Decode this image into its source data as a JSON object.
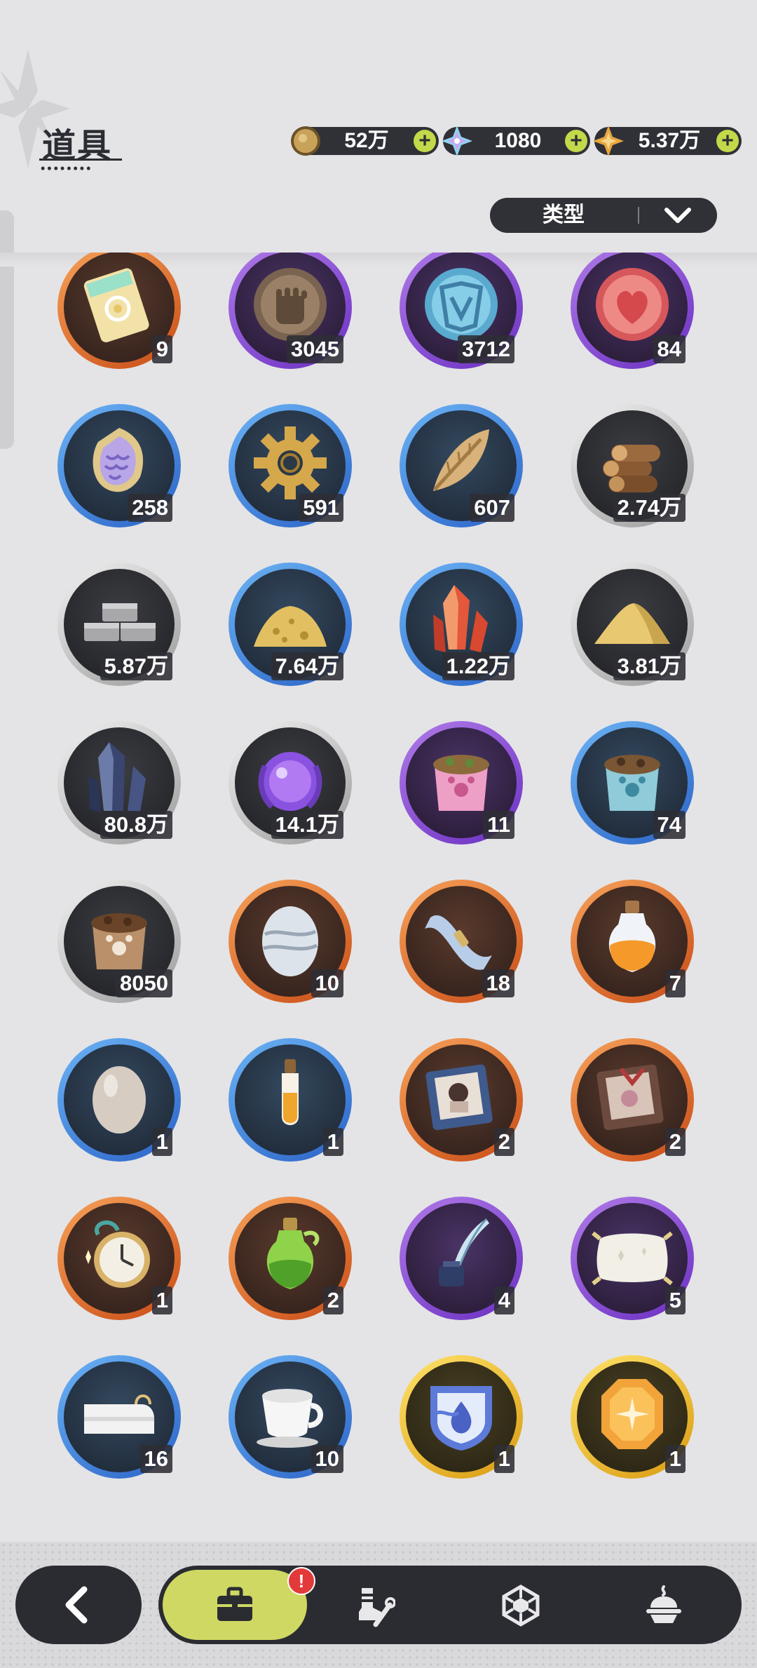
{
  "header": {
    "title": "道具"
  },
  "currencies": [
    {
      "name": "gold-coin",
      "amount": "52万",
      "plus": "+",
      "color": "#c9a25a"
    },
    {
      "name": "crystal-gem",
      "amount": "1080",
      "plus": "+",
      "color": "#8fd3f0"
    },
    {
      "name": "star-shard",
      "amount": "5.37万",
      "plus": "+",
      "color": "#e8a640"
    }
  ],
  "filter": {
    "label": "类型"
  },
  "items": [
    {
      "icon": "rainbow-ticket-icon",
      "rarity": "orange",
      "count": "9"
    },
    {
      "icon": "fist-coin-icon",
      "rarity": "purple",
      "count": "3045"
    },
    {
      "icon": "blue-emblem-coin-icon",
      "rarity": "purple",
      "count": "3712"
    },
    {
      "icon": "heart-coin-icon",
      "rarity": "purple",
      "count": "84"
    },
    {
      "icon": "scale-shield-icon",
      "rarity": "blue",
      "count": "258"
    },
    {
      "icon": "gear-icon",
      "rarity": "blue",
      "count": "591"
    },
    {
      "icon": "gold-leaf-icon",
      "rarity": "blue",
      "count": "607"
    },
    {
      "icon": "wood-logs-icon",
      "rarity": "gray",
      "count": "2.74万"
    },
    {
      "icon": "stone-bricks-icon",
      "rarity": "gray",
      "count": "5.87万"
    },
    {
      "icon": "gold-ore-pile-icon",
      "rarity": "blue",
      "count": "7.64万"
    },
    {
      "icon": "red-crystal-icon",
      "rarity": "blue",
      "count": "1.22万"
    },
    {
      "icon": "sand-pile-icon",
      "rarity": "gray",
      "count": "3.81万"
    },
    {
      "icon": "dark-crystal-icon",
      "rarity": "gray",
      "count": "80.8万"
    },
    {
      "icon": "purple-orb-icon",
      "rarity": "gray",
      "count": "14.1万"
    },
    {
      "icon": "pink-pet-food-bag-icon",
      "rarity": "purple",
      "count": "11"
    },
    {
      "icon": "blue-pet-food-bag-icon",
      "rarity": "blue",
      "count": "74"
    },
    {
      "icon": "brown-pet-food-bag-icon",
      "rarity": "gray",
      "count": "8050"
    },
    {
      "icon": "marbled-egg-icon",
      "rarity": "orange",
      "count": "10"
    },
    {
      "icon": "cloth-bolt-icon",
      "rarity": "orange",
      "count": "18"
    },
    {
      "icon": "orange-potion-bottle-icon",
      "rarity": "orange",
      "count": "7"
    },
    {
      "icon": "plain-egg-icon",
      "rarity": "blue",
      "count": "1"
    },
    {
      "icon": "amber-vial-icon",
      "rarity": "blue",
      "count": "1"
    },
    {
      "icon": "portrait-book-icon",
      "rarity": "orange",
      "count": "2"
    },
    {
      "icon": "ribbon-book-icon",
      "rarity": "orange",
      "count": "2"
    },
    {
      "icon": "pocket-watch-icon",
      "rarity": "orange",
      "count": "1"
    },
    {
      "icon": "green-potion-icon",
      "rarity": "orange",
      "count": "2"
    },
    {
      "icon": "quill-ink-icon",
      "rarity": "purple",
      "count": "4"
    },
    {
      "icon": "pillow-icon",
      "rarity": "purple",
      "count": "5"
    },
    {
      "icon": "towel-icon",
      "rarity": "blue",
      "count": "16"
    },
    {
      "icon": "teacup-icon",
      "rarity": "blue",
      "count": "10"
    },
    {
      "icon": "water-badge-icon",
      "rarity": "gold",
      "count": "1"
    },
    {
      "icon": "amber-gem-icon",
      "rarity": "gold",
      "count": "1"
    }
  ],
  "nav": {
    "badge": "!",
    "items": [
      {
        "icon": "briefcase-icon",
        "active": true
      },
      {
        "icon": "boot-wrench-icon",
        "active": false
      },
      {
        "icon": "hexagon-gem-icon",
        "active": false
      },
      {
        "icon": "cream-dessert-icon",
        "active": false
      }
    ]
  }
}
